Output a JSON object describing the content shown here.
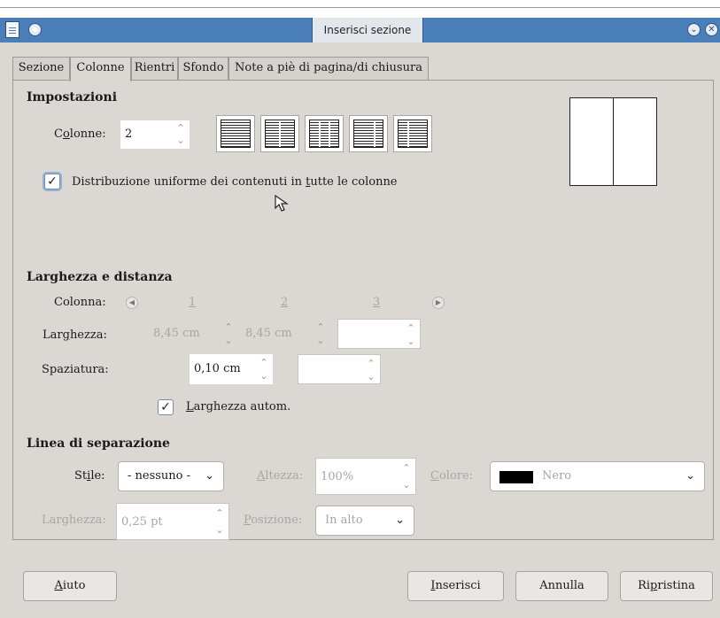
{
  "window": {
    "title": "Inserisci sezione"
  },
  "tabs": [
    {
      "label": "Sezione"
    },
    {
      "label": "Colonne"
    },
    {
      "label": "Rientri"
    },
    {
      "label": "Sfondo"
    },
    {
      "label": "Note a piè di pagina/di chiusura"
    }
  ],
  "active_tab": "Colonne",
  "settings": {
    "heading": "Impostazioni",
    "columns_label_pre": "C",
    "columns_label_u": "o",
    "columns_label_post": "lonne:",
    "columns_value": "2",
    "presets": [
      "1 colonna",
      "2 colonne",
      "3 colonne",
      "sinistra",
      "destra"
    ],
    "even_distribution": {
      "checked": true,
      "label_pre": "Distribuzione uniforme dei contenuti in ",
      "label_u": "t",
      "label_post": "utte le colonne"
    }
  },
  "width_spacing": {
    "heading": "Larghezza e distanza",
    "column_label": "Colonna:",
    "column_numbers": [
      "1",
      "2",
      "3"
    ],
    "width_label_pre": "Lar",
    "width_label_u": "g",
    "width_label_post": "hezza:",
    "width_values": [
      "8,45 cm",
      "8,45 cm",
      ""
    ],
    "spacing_label": "Spaziatura:",
    "spacing_values": [
      "0,10 cm",
      ""
    ],
    "auto_width": {
      "checked": true,
      "label_u": "L",
      "label_post": "arghezza autom."
    }
  },
  "separator_line": {
    "heading": "Linea di separazione",
    "style_label_pre": "St",
    "style_label_u": "i",
    "style_label_post": "le:",
    "style_value": "- nessuno -",
    "height_label_u": "A",
    "height_label_post": "ltezza:",
    "height_value": "100%",
    "color_label_u": "C",
    "color_label_post": "olore:",
    "color_value": "Nero",
    "color_swatch": "#000000",
    "width_label": "Larghezza:",
    "width_value": "0,25 pt",
    "position_label_u": "P",
    "position_label_post": "osizione:",
    "position_value": "In alto"
  },
  "buttons": {
    "help_u": "A",
    "help_post": "iuto",
    "insert_u": "I",
    "insert_post": "nserisci",
    "cancel": "Annulla",
    "reset_pre": "Ri",
    "reset_u": "p",
    "reset_post": "ristina"
  },
  "colors": {
    "titlebar": "#4a7fba",
    "dialog_bg": "#dbd8d3"
  }
}
